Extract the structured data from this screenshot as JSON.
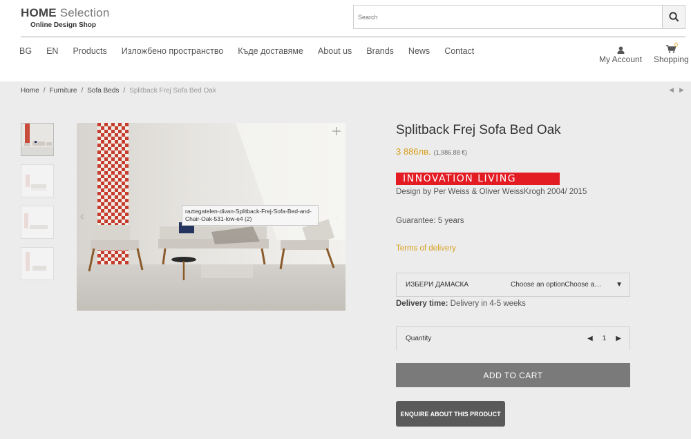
{
  "header": {
    "logo_bold": "HOME",
    "logo_light": " Selection",
    "logo_sub": "Online Design Shop",
    "search_placeholder": "Search",
    "nav": [
      "BG",
      "EN",
      "Products",
      "Изложбено пространство",
      "Къде доставяме",
      "About us",
      "Brands",
      "News",
      "Contact"
    ],
    "account_label": "My Account",
    "shopping_label": "Shopping",
    "cart_count": "0"
  },
  "breadcrumb": {
    "items": [
      "Home",
      "Furniture",
      "Sofa Beds"
    ],
    "current": "Splitback Frej Sofa Bed Oak",
    "sep": "/"
  },
  "gallery": {
    "tooltip": "raztegatelen-divan-Splitback-Frej-Sofa-Bed-and-Chair-Oak-531-low-e4 (2)"
  },
  "product": {
    "title": "Splitback Frej Sofa Bed Oak",
    "price": "3 886лв.",
    "price_eur": "(1,986.88 €)",
    "brand_logo": "INNOVATION LIVING",
    "designer": "Design by Per Weiss & Oliver WeissKrogh 2004/ 2015",
    "guarantee": "Guarantee: 5 years",
    "terms": "Terms of delivery",
    "option_label": "ИЗБЕРИ ДАМАСКА",
    "option_value": "Choose an optionChoose an option",
    "delivery_label": "Delivery time:",
    "delivery_value": " Delivery in 4-5 weeks",
    "quantity_label": "Quantity",
    "quantity_value": "1",
    "add_to_cart": "ADD TO CART",
    "enquire": "ENQUIRE ABOUT THIS PRODUCT"
  },
  "colors": {
    "accent": "#d8a020",
    "brand_red": "#e31b23",
    "button_gray": "#7a7a7a",
    "button_dark": "#5a5a5a"
  }
}
